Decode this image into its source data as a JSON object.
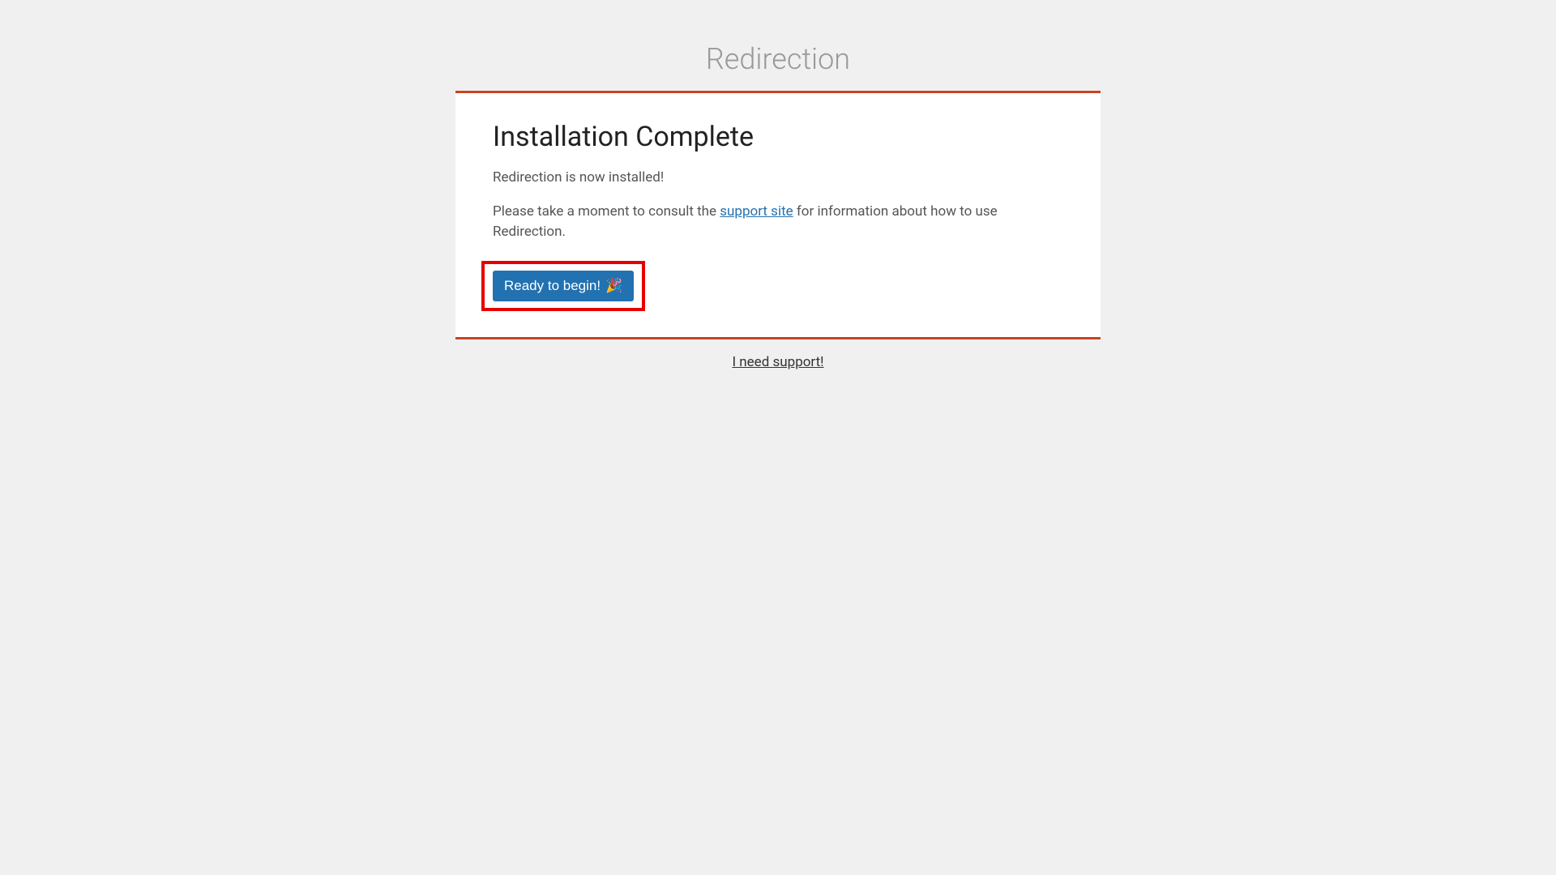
{
  "header": {
    "title": "Redirection"
  },
  "card": {
    "heading": "Installation Complete",
    "intro_text": "Redirection is now installed!",
    "consult_prefix": "Please take a moment to consult the ",
    "consult_link": "support site",
    "consult_suffix": " for information about how to use Redirection.",
    "button_label": "Ready to begin!",
    "button_emoji": "🎉"
  },
  "footer": {
    "support_link": "I need support!"
  }
}
